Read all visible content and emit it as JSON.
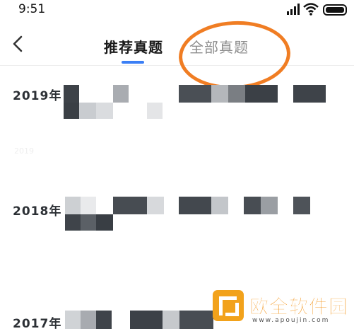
{
  "status_bar": {
    "time": "9:51",
    "icons": [
      "signal-icon",
      "wifi-icon",
      "battery-icon"
    ]
  },
  "nav": {
    "back_icon": "chevron-left-icon",
    "tabs": [
      {
        "label": "推荐真题",
        "active": true
      },
      {
        "label": "全部真题",
        "active": false
      }
    ],
    "accent_color": "#3b7ff5",
    "highlight_color": "#f07d23"
  },
  "list": {
    "items": [
      {
        "title": "2019年",
        "subtitle": "2019"
      },
      {
        "title": "2018年",
        "subtitle": ""
      },
      {
        "title": "2017年",
        "subtitle": ""
      }
    ]
  },
  "watermark": {
    "name": "欧全软件园",
    "url": "www.apoujin.com"
  }
}
